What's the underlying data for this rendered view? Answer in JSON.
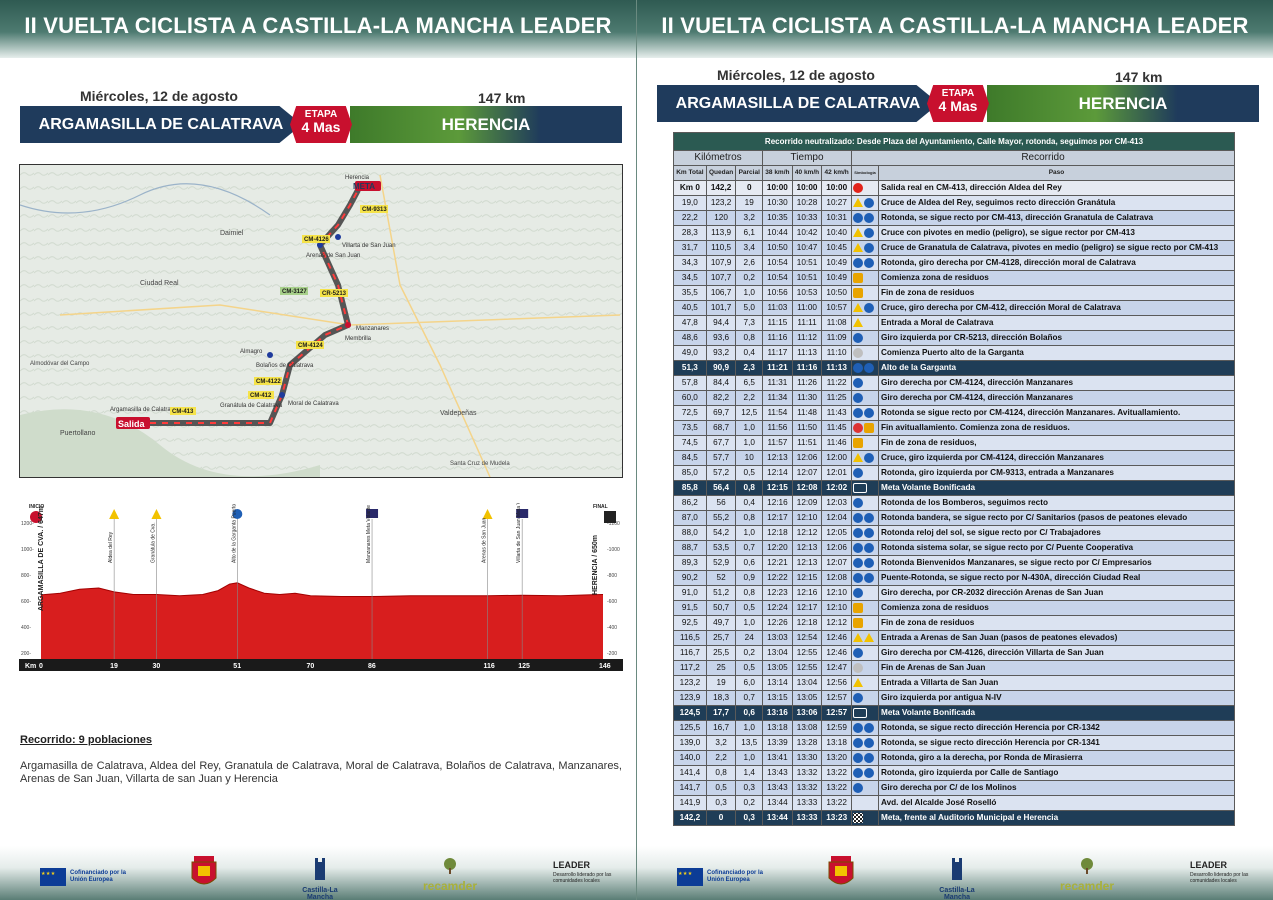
{
  "header": {
    "title": "II VUELTA CICLISTA A CASTILLA-LA MANCHA LEADER"
  },
  "stage": {
    "date": "Miércoles, 12 de agosto",
    "distance": "147 km",
    "start": "ARGAMASILLA DE CALATRAVA",
    "finish": "HERENCIA",
    "badge_line1": "ETAPA",
    "badge_line2": "4 Mas"
  },
  "map": {
    "labels": {
      "meta": "META",
      "salida": "Salida",
      "herencia": "Herencia",
      "manzanares": "Manzanares",
      "membrilla": "Membrilla",
      "bolanos": "Bolaños de Calatrava",
      "almagro": "Almagro",
      "granatula": "Granátula de Calatrava",
      "moral": "Moral de Calatrava",
      "argamasilla": "Argamasilla de Calatrava",
      "arenas": "Arenas de San Juan",
      "villarta": "Villarta de San Juan",
      "ciudad_real": "Ciudad Real",
      "puertollano": "Puertollano",
      "daimiel": "Daimiel",
      "valdepenas": "Valdepeñas",
      "santa_cruz": "Santa Cruz de Mudela",
      "almadén": "Almodóvar del Campo"
    },
    "roads": [
      "CM-413",
      "CM-412",
      "CM-4122",
      "CM-4124",
      "CR-5213",
      "CM-4126",
      "CM-9313",
      "CM-3127"
    ]
  },
  "profile": {
    "start_label": "INICIO",
    "final_label": "FINAL",
    "start_town": "ARGAMASILLA DE CVA. / 647m",
    "finish_town": "HERENCIA / 650m",
    "km_prefix": "Km",
    "km_ticks": [
      "0",
      "19",
      "30",
      "51",
      "70",
      "86",
      "116",
      "125",
      "146"
    ],
    "left_axis": [
      "1200-",
      "1000-",
      "800-",
      "600-",
      "400-",
      "200-"
    ],
    "right_axis": [
      "-1200",
      "-1000",
      "-800",
      "-600",
      "-400",
      "-200"
    ],
    "markers": [
      {
        "km": 19,
        "label": "Aldea del Rey",
        "type": "warn"
      },
      {
        "km": 30,
        "label": "Granátula de Cva.",
        "type": "warn"
      },
      {
        "km": 51,
        "label": "Alto de la Garganta Puerto Montaña",
        "type": "climb"
      },
      {
        "km": 86,
        "label": "Manzanares Meta Volante",
        "type": "mv"
      },
      {
        "km": 116,
        "label": "Arenas de San Juan",
        "type": "warn"
      },
      {
        "km": 125,
        "label": "Villarta de San Juan Meta Volante",
        "type": "mv"
      }
    ],
    "elevation": [
      [
        0,
        647
      ],
      [
        5,
        660
      ],
      [
        10,
        690
      ],
      [
        15,
        700
      ],
      [
        19,
        670
      ],
      [
        24,
        650
      ],
      [
        30,
        650
      ],
      [
        36,
        640
      ],
      [
        42,
        650
      ],
      [
        46,
        680
      ],
      [
        49,
        730
      ],
      [
        51,
        740
      ],
      [
        54,
        700
      ],
      [
        58,
        660
      ],
      [
        62,
        650
      ],
      [
        66,
        660
      ],
      [
        70,
        640
      ],
      [
        78,
        635
      ],
      [
        86,
        635
      ],
      [
        96,
        640
      ],
      [
        106,
        640
      ],
      [
        116,
        640
      ],
      [
        125,
        645
      ],
      [
        135,
        640
      ],
      [
        143,
        648
      ],
      [
        146,
        650
      ]
    ]
  },
  "route": {
    "title": "Recorrido: 9 poblaciones",
    "towns": "Argamasilla de Calatrava, Aldea del Rey, Granatula de Calatrava, Moral de Calatrava, Bolaños de Calatrava, Manzanares, Arenas de San Juan, Villarta de san Juan y Herencia"
  },
  "footer": {
    "eu": "Cofinanciado por la Unión Europea",
    "clm": "Castilla-La Mancha",
    "recam": "recamder",
    "leader": "LEADER",
    "leader_sub": "Desarrollo liderado por las comunidades locales"
  },
  "table": {
    "neutral": "Recorrido neutralizado: Desde Plaza del Ayuntamiento, Calle Mayor, rotonda, seguimos por CM-413",
    "headers": {
      "km": "Kilómetros",
      "tiempo": "Tiempo",
      "recorrido": "Recorrido",
      "km_total": "Km Total",
      "quedan": "Quedan",
      "parcial": "Parcial",
      "v38": "38 km/h",
      "v40": "40 km/h",
      "v42": "42 km/h",
      "simbologia": "Simbología",
      "paso": "Paso"
    },
    "rows": [
      {
        "kt": "Km 0",
        "q": "142,2",
        "p": "0",
        "t1": "10:00",
        "t2": "10:00",
        "t3": "10:00",
        "ic": [
          "start"
        ],
        "paso": "Salida real en CM-413, dirección Aldea del Rey",
        "cls": "first"
      },
      {
        "kt": "19,0",
        "q": "123,2",
        "p": "19",
        "t1": "10:30",
        "t2": "10:28",
        "t3": "10:27",
        "ic": [
          "warn",
          "dir"
        ],
        "paso": "Cruce de Aldea del Rey, seguimos recto dirección Granátula"
      },
      {
        "kt": "22,2",
        "q": "120",
        "p": "3,2",
        "t1": "10:35",
        "t2": "10:33",
        "t3": "10:31",
        "ic": [
          "dir",
          "dir"
        ],
        "paso": "Rotonda, se sigue recto por CM-413, dirección Granatula de Calatrava"
      },
      {
        "kt": "28,3",
        "q": "113,9",
        "p": "6,1",
        "t1": "10:44",
        "t2": "10:42",
        "t3": "10:40",
        "ic": [
          "warn",
          "dir"
        ],
        "paso": "Cruce con pivotes en medio (peligro), se sigue rector por CM-413"
      },
      {
        "kt": "31,7",
        "q": "110,5",
        "p": "3,4",
        "t1": "10:50",
        "t2": "10:47",
        "t3": "10:45",
        "ic": [
          "warn",
          "dir"
        ],
        "paso": "Cruce de Granatula de Calatrava, pivotes en medio (peligro) se sigue recto por CM-413"
      },
      {
        "kt": "34,3",
        "q": "107,9",
        "p": "2,6",
        "t1": "10:54",
        "t2": "10:51",
        "t3": "10:49",
        "ic": [
          "dir",
          "dir"
        ],
        "paso": "Rotonda, giro derecha por CM-4128, dirección moral de Calatrava"
      },
      {
        "kt": "34,5",
        "q": "107,7",
        "p": "0,2",
        "t1": "10:54",
        "t2": "10:51",
        "t3": "10:49",
        "ic": [
          "food"
        ],
        "paso": "Comienza zona de residuos"
      },
      {
        "kt": "35,5",
        "q": "106,7",
        "p": "1,0",
        "t1": "10:56",
        "t2": "10:53",
        "t3": "10:50",
        "ic": [
          "food"
        ],
        "paso": "Fin de zona de residuos"
      },
      {
        "kt": "40,5",
        "q": "101,7",
        "p": "5,0",
        "t1": "11:03",
        "t2": "11:00",
        "t3": "10:57",
        "ic": [
          "warn",
          "dir"
        ],
        "paso": "Cruce, giro derecha por CM-412, dirección Moral de Calatrava"
      },
      {
        "kt": "47,8",
        "q": "94,4",
        "p": "7,3",
        "t1": "11:15",
        "t2": "11:11",
        "t3": "11:08",
        "ic": [
          "warn"
        ],
        "paso": "Entrada a Moral de Calatrava"
      },
      {
        "kt": "48,6",
        "q": "93,6",
        "p": "0,8",
        "t1": "11:16",
        "t2": "11:12",
        "t3": "11:09",
        "ic": [
          "dir"
        ],
        "paso": "Giro izquierda por CR-5213, dirección Bolaños"
      },
      {
        "kt": "49,0",
        "q": "93,2",
        "p": "0,4",
        "t1": "11:17",
        "t2": "11:13",
        "t3": "11:10",
        "ic": [
          "gray"
        ],
        "paso": "Comienza Puerto alto de la Garganta"
      },
      {
        "kt": "51,3",
        "q": "90,9",
        "p": "2,3",
        "t1": "11:21",
        "t2": "11:16",
        "t3": "11:13",
        "ic": [
          "dir",
          "dir"
        ],
        "paso": "Alto de la Garganta",
        "cls": "hl"
      },
      {
        "kt": "57,8",
        "q": "84,4",
        "p": "6,5",
        "t1": "11:31",
        "t2": "11:26",
        "t3": "11:22",
        "ic": [
          "dir"
        ],
        "paso": "Giro derecha por CM-4124, dirección Manzanares"
      },
      {
        "kt": "60,0",
        "q": "82,2",
        "p": "2,2",
        "t1": "11:34",
        "t2": "11:30",
        "t3": "11:25",
        "ic": [
          "dir"
        ],
        "paso": "Giro derecha por CM-4124, dirección Manzanares"
      },
      {
        "kt": "72,5",
        "q": "69,7",
        "p": "12,5",
        "t1": "11:54",
        "t2": "11:48",
        "t3": "11:43",
        "ic": [
          "dir",
          "dir"
        ],
        "paso": "Rotonda se sigue recto por CM-4124, dirección Manzanares. Avituallamiento."
      },
      {
        "kt": "73,5",
        "q": "68,7",
        "p": "1,0",
        "t1": "11:56",
        "t2": "11:50",
        "t3": "11:45",
        "ic": [
          "red",
          "food"
        ],
        "paso": "Fin avituallamiento. Comienza zona de residuos."
      },
      {
        "kt": "74,5",
        "q": "67,7",
        "p": "1,0",
        "t1": "11:57",
        "t2": "11:51",
        "t3": "11:46",
        "ic": [
          "food"
        ],
        "paso": "Fin de zona de residuos,"
      },
      {
        "kt": "84,5",
        "q": "57,7",
        "p": "10",
        "t1": "12:13",
        "t2": "12:06",
        "t3": "12:00",
        "ic": [
          "warn",
          "dir"
        ],
        "paso": "Cruce, giro izquierda por CM-4124, dirección Manzanares"
      },
      {
        "kt": "85,0",
        "q": "57,2",
        "p": "0,5",
        "t1": "12:14",
        "t2": "12:07",
        "t3": "12:01",
        "ic": [
          "dir"
        ],
        "paso": "Rotonda, giro izquierda por CM-9313, entrada a Manzanares"
      },
      {
        "kt": "85,8",
        "q": "56,4",
        "p": "0,8",
        "t1": "12:15",
        "t2": "12:08",
        "t3": "12:02",
        "ic": [
          "mv"
        ],
        "paso": "Meta Volante Bonificada",
        "cls": "hl"
      },
      {
        "kt": "86,2",
        "q": "56",
        "p": "0,4",
        "t1": "12:16",
        "t2": "12:09",
        "t3": "12:03",
        "ic": [
          "dir"
        ],
        "paso": "Rotonda de los Bomberos, seguimos recto"
      },
      {
        "kt": "87,0",
        "q": "55,2",
        "p": "0,8",
        "t1": "12:17",
        "t2": "12:10",
        "t3": "12:04",
        "ic": [
          "dir",
          "dir"
        ],
        "paso": "Rotonda bandera, se sigue recto por C/ Sanitarios (pasos de peatones elevado"
      },
      {
        "kt": "88,0",
        "q": "54,2",
        "p": "1,0",
        "t1": "12:18",
        "t2": "12:12",
        "t3": "12:05",
        "ic": [
          "dir",
          "dir"
        ],
        "paso": "Rotonda reloj del sol, se sigue recto por C/ Trabajadores"
      },
      {
        "kt": "88,7",
        "q": "53,5",
        "p": "0,7",
        "t1": "12:20",
        "t2": "12:13",
        "t3": "12:06",
        "ic": [
          "dir",
          "dir"
        ],
        "paso": "Rotonda sistema solar, se sigue recto por C/ Puente Cooperativa"
      },
      {
        "kt": "89,3",
        "q": "52,9",
        "p": "0,6",
        "t1": "12:21",
        "t2": "12:13",
        "t3": "12:07",
        "ic": [
          "dir",
          "dir"
        ],
        "paso": "Rotonda Bienvenidos Manzanares, se sigue recto por C/ Empresarios"
      },
      {
        "kt": "90,2",
        "q": "52",
        "p": "0,9",
        "t1": "12:22",
        "t2": "12:15",
        "t3": "12:08",
        "ic": [
          "dir",
          "dir"
        ],
        "paso": "Puente-Rotonda, se sigue recto por N-430A, dirección Ciudad Real"
      },
      {
        "kt": "91,0",
        "q": "51,2",
        "p": "0,8",
        "t1": "12:23",
        "t2": "12:16",
        "t3": "12:10",
        "ic": [
          "dir"
        ],
        "paso": "Giro derecha, por CR-2032 dirección Arenas de San Juan"
      },
      {
        "kt": "91,5",
        "q": "50,7",
        "p": "0,5",
        "t1": "12:24",
        "t2": "12:17",
        "t3": "12:10",
        "ic": [
          "food"
        ],
        "paso": "Comienza zona de residuos"
      },
      {
        "kt": "92,5",
        "q": "49,7",
        "p": "1,0",
        "t1": "12:26",
        "t2": "12:18",
        "t3": "12:12",
        "ic": [
          "food"
        ],
        "paso": "Fin de zona de residuos"
      },
      {
        "kt": "116,5",
        "q": "25,7",
        "p": "24",
        "t1": "13:03",
        "t2": "12:54",
        "t3": "12:46",
        "ic": [
          "warn",
          "warn"
        ],
        "paso": "Entrada a Arenas de San Juan (pasos de peatones elevados)"
      },
      {
        "kt": "116,7",
        "q": "25,5",
        "p": "0,2",
        "t1": "13:04",
        "t2": "12:55",
        "t3": "12:46",
        "ic": [
          "dir"
        ],
        "paso": "Giro derecha por CM-4126, dirección Villarta de San Juan"
      },
      {
        "kt": "117,2",
        "q": "25",
        "p": "0,5",
        "t1": "13:05",
        "t2": "12:55",
        "t3": "12:47",
        "ic": [
          "gray"
        ],
        "paso": "Fin de Arenas de San Juan"
      },
      {
        "kt": "123,2",
        "q": "19",
        "p": "6,0",
        "t1": "13:14",
        "t2": "13:04",
        "t3": "12:56",
        "ic": [
          "warn"
        ],
        "paso": "Entrada a Villarta de San Juan"
      },
      {
        "kt": "123,9",
        "q": "18,3",
        "p": "0,7",
        "t1": "13:15",
        "t2": "13:05",
        "t3": "12:57",
        "ic": [
          "dir"
        ],
        "paso": "Giro izquierda por antigua N-IV"
      },
      {
        "kt": "124,5",
        "q": "17,7",
        "p": "0,6",
        "t1": "13:16",
        "t2": "13:06",
        "t3": "12:57",
        "ic": [
          "mv"
        ],
        "paso": "Meta Volante Bonificada",
        "cls": "hl"
      },
      {
        "kt": "125,5",
        "q": "16,7",
        "p": "1,0",
        "t1": "13:18",
        "t2": "13:08",
        "t3": "12:59",
        "ic": [
          "dir",
          "dir"
        ],
        "paso": "Rotonda, se sigue recto dirección Herencia por CR-1342"
      },
      {
        "kt": "139,0",
        "q": "3,2",
        "p": "13,5",
        "t1": "13:39",
        "t2": "13:28",
        "t3": "13:18",
        "ic": [
          "dir",
          "dir"
        ],
        "paso": "Rotonda, se sigue recto dirección Herencia por CR-1341"
      },
      {
        "kt": "140,0",
        "q": "2,2",
        "p": "1,0",
        "t1": "13:41",
        "t2": "13:30",
        "t3": "13:20",
        "ic": [
          "dir",
          "dir"
        ],
        "paso": "Rotonda, giro a la derecha, por Ronda de Mirasierra"
      },
      {
        "kt": "141,4",
        "q": "0,8",
        "p": "1,4",
        "t1": "13:43",
        "t2": "13:32",
        "t3": "13:22",
        "ic": [
          "dir",
          "dir"
        ],
        "paso": "Rotonda, giro izquierda por Calle de Santiago"
      },
      {
        "kt": "141,7",
        "q": "0,5",
        "p": "0,3",
        "t1": "13:43",
        "t2": "13:32",
        "t3": "13:22",
        "ic": [
          "dir"
        ],
        "paso": "Giro derecha por C/ de los Molinos"
      },
      {
        "kt": "141,9",
        "q": "0,3",
        "p": "0,2",
        "t1": "13:44",
        "t2": "13:33",
        "t3": "13:22",
        "ic": [],
        "paso": "Avd. del Alcalde José Roselló"
      },
      {
        "kt": "142,2",
        "q": "0",
        "p": "0,3",
        "t1": "13:44",
        "t2": "13:33",
        "t3": "13:23",
        "ic": [
          "chk"
        ],
        "paso": "Meta, frente al Auditorio Municipal e Herencia",
        "cls": "hl"
      }
    ]
  },
  "colors": {
    "banner": "#2f5a52",
    "stage_start": "#1f3b5c",
    "stage_finish": "#3e7a2a",
    "badge": "#c8102e",
    "profile_fill": "#d81e1e",
    "highlight_row": "#1f3d57"
  }
}
